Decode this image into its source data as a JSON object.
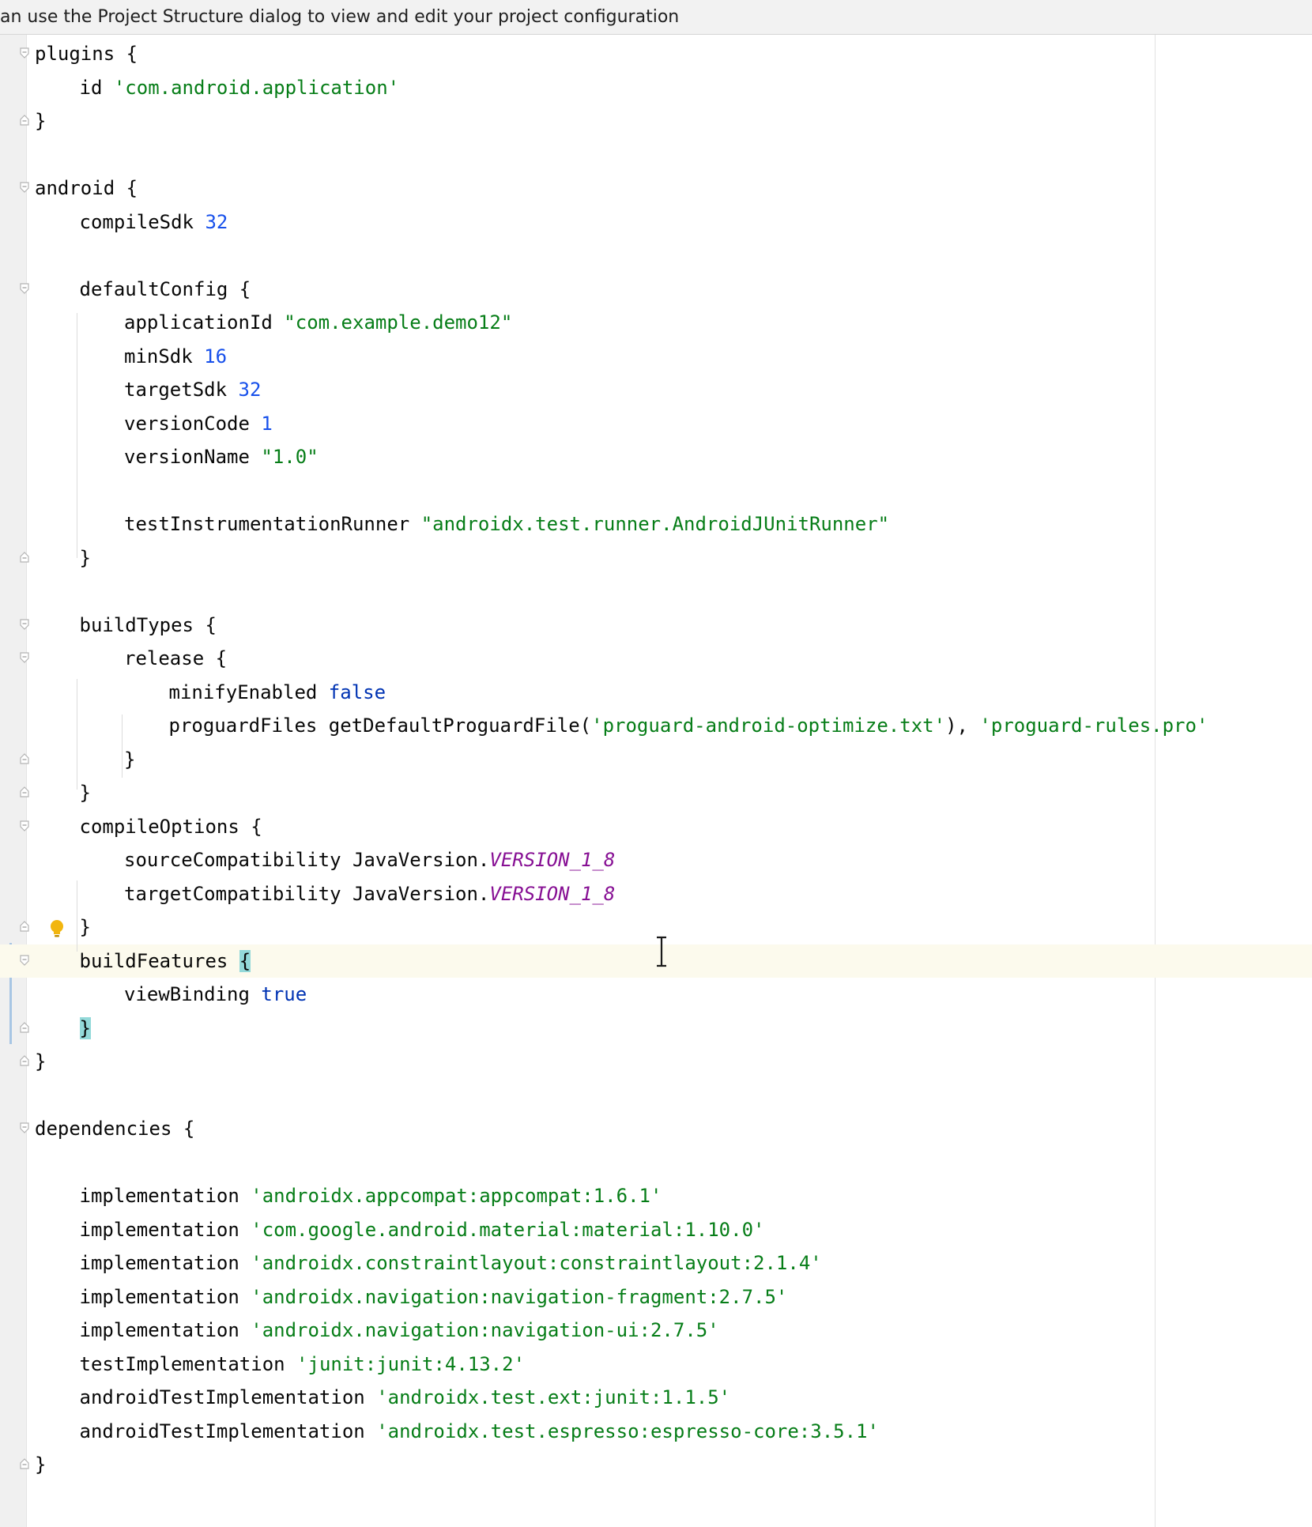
{
  "banner": {
    "text": "an use the Project Structure dialog to view and edit your project configuration"
  },
  "editor": {
    "lines": [
      {
        "indent": 0,
        "parts": [
          {
            "t": "plugins {",
            "c": ""
          }
        ]
      },
      {
        "indent": 1,
        "parts": [
          {
            "t": "id ",
            "c": ""
          },
          {
            "t": "'com.android.application'",
            "c": "str"
          }
        ]
      },
      {
        "indent": 0,
        "parts": [
          {
            "t": "}",
            "c": ""
          }
        ]
      },
      {
        "indent": 0,
        "parts": []
      },
      {
        "indent": 0,
        "parts": [
          {
            "t": "android {",
            "c": ""
          }
        ]
      },
      {
        "indent": 1,
        "parts": [
          {
            "t": "compileSdk ",
            "c": ""
          },
          {
            "t": "32",
            "c": "num"
          }
        ]
      },
      {
        "indent": 0,
        "parts": []
      },
      {
        "indent": 1,
        "parts": [
          {
            "t": "defaultConfig {",
            "c": ""
          }
        ]
      },
      {
        "indent": 2,
        "parts": [
          {
            "t": "applicationId ",
            "c": ""
          },
          {
            "t": "\"com.example.demo12\"",
            "c": "str"
          }
        ]
      },
      {
        "indent": 2,
        "parts": [
          {
            "t": "minSdk ",
            "c": ""
          },
          {
            "t": "16",
            "c": "num"
          }
        ]
      },
      {
        "indent": 2,
        "parts": [
          {
            "t": "targetSdk ",
            "c": ""
          },
          {
            "t": "32",
            "c": "num"
          }
        ]
      },
      {
        "indent": 2,
        "parts": [
          {
            "t": "versionCode ",
            "c": ""
          },
          {
            "t": "1",
            "c": "num"
          }
        ]
      },
      {
        "indent": 2,
        "parts": [
          {
            "t": "versionName ",
            "c": ""
          },
          {
            "t": "\"1.0\"",
            "c": "str"
          }
        ]
      },
      {
        "indent": 0,
        "parts": []
      },
      {
        "indent": 2,
        "parts": [
          {
            "t": "testInstrumentationRunner ",
            "c": ""
          },
          {
            "t": "\"androidx.test.runner.AndroidJUnitRunner\"",
            "c": "str"
          }
        ]
      },
      {
        "indent": 1,
        "parts": [
          {
            "t": "}",
            "c": ""
          }
        ]
      },
      {
        "indent": 0,
        "parts": []
      },
      {
        "indent": 1,
        "parts": [
          {
            "t": "buildTypes {",
            "c": ""
          }
        ]
      },
      {
        "indent": 2,
        "parts": [
          {
            "t": "release {",
            "c": ""
          }
        ]
      },
      {
        "indent": 3,
        "parts": [
          {
            "t": "minifyEnabled ",
            "c": ""
          },
          {
            "t": "false",
            "c": "kw"
          }
        ]
      },
      {
        "indent": 3,
        "parts": [
          {
            "t": "proguardFiles getDefaultProguardFile(",
            "c": ""
          },
          {
            "t": "'proguard-android-optimize.txt'",
            "c": "str"
          },
          {
            "t": "), ",
            "c": ""
          },
          {
            "t": "'proguard-rules.pro'",
            "c": "str"
          }
        ]
      },
      {
        "indent": 2,
        "parts": [
          {
            "t": "}",
            "c": ""
          }
        ]
      },
      {
        "indent": 1,
        "parts": [
          {
            "t": "}",
            "c": ""
          }
        ]
      },
      {
        "indent": 1,
        "parts": [
          {
            "t": "compileOptions {",
            "c": ""
          }
        ]
      },
      {
        "indent": 2,
        "parts": [
          {
            "t": "sourceCompatibility JavaVersion.",
            "c": ""
          },
          {
            "t": "VERSION_1_8",
            "c": "const"
          }
        ]
      },
      {
        "indent": 2,
        "parts": [
          {
            "t": "targetCompatibility JavaVersion.",
            "c": ""
          },
          {
            "t": "VERSION_1_8",
            "c": "const"
          }
        ]
      },
      {
        "indent": 1,
        "parts": [
          {
            "t": "}",
            "c": ""
          }
        ]
      },
      {
        "indent": 1,
        "parts": [
          {
            "t": "buildFeatures ",
            "c": ""
          },
          {
            "t": "{",
            "c": "match"
          }
        ]
      },
      {
        "indent": 2,
        "parts": [
          {
            "t": "viewBinding ",
            "c": ""
          },
          {
            "t": "true",
            "c": "kw"
          }
        ]
      },
      {
        "indent": 1,
        "parts": [
          {
            "t": "}",
            "c": "match"
          }
        ]
      },
      {
        "indent": 0,
        "parts": [
          {
            "t": "}",
            "c": ""
          }
        ]
      },
      {
        "indent": 0,
        "parts": []
      },
      {
        "indent": 0,
        "parts": [
          {
            "t": "dependencies {",
            "c": ""
          }
        ]
      },
      {
        "indent": 0,
        "parts": []
      },
      {
        "indent": 1,
        "parts": [
          {
            "t": "implementation ",
            "c": ""
          },
          {
            "t": "'androidx.appcompat:appcompat:1.6.1'",
            "c": "str"
          }
        ]
      },
      {
        "indent": 1,
        "parts": [
          {
            "t": "implementation ",
            "c": ""
          },
          {
            "t": "'com.google.android.material:material:1.10.0'",
            "c": "str"
          }
        ]
      },
      {
        "indent": 1,
        "parts": [
          {
            "t": "implementation ",
            "c": ""
          },
          {
            "t": "'androidx.constraintlayout:constraintlayout:2.1.4'",
            "c": "str"
          }
        ]
      },
      {
        "indent": 1,
        "parts": [
          {
            "t": "implementation ",
            "c": ""
          },
          {
            "t": "'androidx.navigation:navigation-fragment:2.7.5'",
            "c": "str"
          }
        ]
      },
      {
        "indent": 1,
        "parts": [
          {
            "t": "implementation ",
            "c": ""
          },
          {
            "t": "'androidx.navigation:navigation-ui:2.7.5'",
            "c": "str"
          }
        ]
      },
      {
        "indent": 1,
        "parts": [
          {
            "t": "testImplementation ",
            "c": ""
          },
          {
            "t": "'junit:junit:4.13.2'",
            "c": "str"
          }
        ]
      },
      {
        "indent": 1,
        "parts": [
          {
            "t": "androidTestImplementation ",
            "c": ""
          },
          {
            "t": "'androidx.test.ext:junit:1.1.5'",
            "c": "str"
          }
        ]
      },
      {
        "indent": 1,
        "parts": [
          {
            "t": "androidTestImplementation ",
            "c": ""
          },
          {
            "t": "'androidx.test.espresso:espresso-core:3.5.1'",
            "c": "str"
          }
        ]
      },
      {
        "indent": 0,
        "parts": [
          {
            "t": "}",
            "c": ""
          }
        ]
      }
    ],
    "fold_open_lines": [
      0,
      4,
      7,
      17,
      18,
      23,
      27,
      32
    ],
    "fold_close_lines": [
      2,
      15,
      21,
      22,
      26,
      29,
      30,
      42
    ],
    "caret_line": 27,
    "bulb_line": 26
  }
}
